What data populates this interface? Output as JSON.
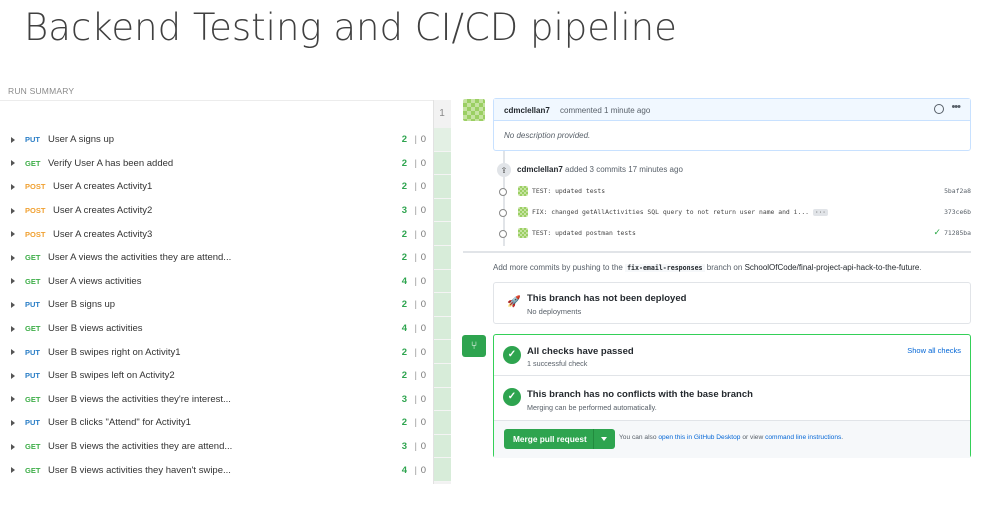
{
  "slide": {
    "title": "Backend Testing and CI/CD pipeline"
  },
  "run_summary": {
    "label": "RUN SUMMARY",
    "column_number": "1",
    "sep": "|",
    "requests": [
      {
        "method": "PUT",
        "name": "User A signs up",
        "pass": "2",
        "fail": "0"
      },
      {
        "method": "GET",
        "name": "Verify User A has been added",
        "pass": "2",
        "fail": "0"
      },
      {
        "method": "POST",
        "name": "User A creates Activity1",
        "pass": "2",
        "fail": "0"
      },
      {
        "method": "POST",
        "name": "User A creates Activity2",
        "pass": "3",
        "fail": "0"
      },
      {
        "method": "POST",
        "name": "User A creates Activity3",
        "pass": "2",
        "fail": "0"
      },
      {
        "method": "GET",
        "name": "User A views the activities they are attend...",
        "pass": "2",
        "fail": "0"
      },
      {
        "method": "GET",
        "name": "User A views activities",
        "pass": "4",
        "fail": "0"
      },
      {
        "method": "PUT",
        "name": "User B signs up",
        "pass": "2",
        "fail": "0"
      },
      {
        "method": "GET",
        "name": "User B views activities",
        "pass": "4",
        "fail": "0"
      },
      {
        "method": "PUT",
        "name": "User B swipes right on Activity1",
        "pass": "2",
        "fail": "0"
      },
      {
        "method": "PUT",
        "name": "User B swipes left on Activity2",
        "pass": "2",
        "fail": "0"
      },
      {
        "method": "GET",
        "name": "User B views the activities they're interest...",
        "pass": "3",
        "fail": "0"
      },
      {
        "method": "PUT",
        "name": "User B clicks \"Attend\" for Activity1",
        "pass": "2",
        "fail": "0"
      },
      {
        "method": "GET",
        "name": "User B views the activities they are attend...",
        "pass": "3",
        "fail": "0"
      },
      {
        "method": "GET",
        "name": "User B views activities they haven't swipe...",
        "pass": "4",
        "fail": "0"
      }
    ]
  },
  "github": {
    "comment": {
      "author": "cdmclellan7",
      "meta": "commented 1 minute ago",
      "body": "No description provided."
    },
    "event": {
      "author": "cdmclellan7",
      "text": "added 3 commits 17 minutes ago"
    },
    "commits": [
      {
        "message": "TEST: updated tests",
        "sha": "5baf2a8",
        "truncated": false,
        "verified": false
      },
      {
        "message": "FIX: changed getAllActivities SQL query to not return user name and i...",
        "sha": "373ce6b",
        "truncated": true,
        "verified": false
      },
      {
        "message": "TEST: updated postman tests",
        "sha": "71285ba",
        "truncated": false,
        "verified": true
      }
    ],
    "commit_more": "···",
    "add_more": {
      "prefix": "Add more commits by pushing to the",
      "branch": "fix-email-responses",
      "middle": "branch on",
      "repo": "SchoolOfCode/final-project-api-hack-to-the-future",
      "suffix": "."
    },
    "deploy": {
      "title": "This branch has not been deployed",
      "subtitle": "No deployments"
    },
    "checks": {
      "title": "All checks have passed",
      "subtitle": "1 successful check",
      "link": "Show all checks"
    },
    "conflicts": {
      "title": "This branch has no conflicts with the base branch",
      "subtitle": "Merging can be performed automatically."
    },
    "merge": {
      "button_label": "Merge pull request",
      "alt_prefix": "You can also",
      "alt_link1": "open this in GitHub Desktop",
      "alt_middle": "or view",
      "alt_link2": "command line instructions",
      "alt_suffix": "."
    },
    "colors": {
      "success": "#2ea44f",
      "link": "#0366d6",
      "comment_header": "#f1f8ff"
    }
  }
}
